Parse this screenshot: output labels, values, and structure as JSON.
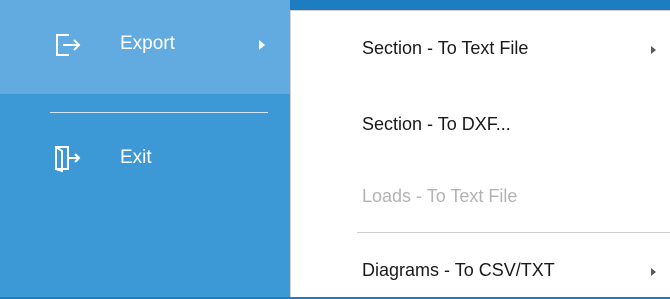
{
  "app_menu": {
    "items": [
      {
        "label": "Export",
        "icon": "export-icon",
        "has_submenu": true,
        "highlighted": true
      },
      {
        "label": "Exit",
        "icon": "exit-icon",
        "has_submenu": false
      }
    ]
  },
  "export_submenu": {
    "items": [
      {
        "label": "Section - To Text File",
        "has_submenu": true,
        "enabled": true
      },
      {
        "label": "Section - To DXF...",
        "has_submenu": false,
        "enabled": true
      },
      {
        "label": "Loads - To Text File",
        "has_submenu": false,
        "enabled": false
      },
      {
        "label": "Diagrams - To CSV/TXT",
        "has_submenu": true,
        "enabled": true
      }
    ]
  },
  "colors": {
    "menu_bg": "#3d99d6",
    "menu_highlight": "#62abe0",
    "submenu_bg": "#ffffff",
    "disabled_text": "#b3b3b3"
  }
}
